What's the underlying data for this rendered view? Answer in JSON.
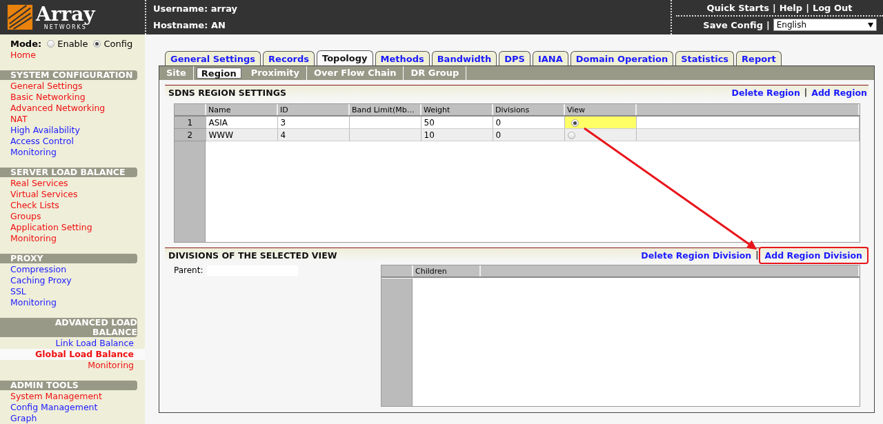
{
  "header": {
    "logo": {
      "name": "Array",
      "tagline": "NETWORKS"
    },
    "username": "Username: array",
    "hostname": "Hostname: AN",
    "links": [
      "Quick Starts",
      "Help",
      "Log Out"
    ],
    "separator": "|",
    "save_config": "Save Config",
    "language": "English"
  },
  "sidebar": {
    "mode_label": "Mode:",
    "modes": [
      {
        "label": "Enable",
        "selected": false
      },
      {
        "label": "Config",
        "selected": true
      }
    ],
    "home": {
      "label": "Home",
      "color": "#f01010"
    },
    "sections": [
      {
        "title": "SYSTEM CONFIGURATION",
        "selected": false,
        "items": [
          {
            "label": "General Settings",
            "color": "#f01010",
            "selected": false
          },
          {
            "label": "Basic Networking",
            "color": "#f01010",
            "selected": false
          },
          {
            "label": "Advanced Networking",
            "color": "#f01010",
            "selected": false
          },
          {
            "label": "NAT",
            "color": "#f01010",
            "selected": false
          },
          {
            "label": "High Availability",
            "color": "#1a1aff",
            "selected": false
          },
          {
            "label": "Access Control",
            "color": "#1a1aff",
            "selected": false
          },
          {
            "label": "Monitoring",
            "color": "#1a1aff",
            "selected": false
          }
        ]
      },
      {
        "title": "SERVER LOAD BALANCE",
        "selected": false,
        "items": [
          {
            "label": "Real Services",
            "color": "#f01010",
            "selected": false
          },
          {
            "label": "Virtual Services",
            "color": "#f01010",
            "selected": false
          },
          {
            "label": "Check Lists",
            "color": "#f01010",
            "selected": false
          },
          {
            "label": "Groups",
            "color": "#f01010",
            "selected": false
          },
          {
            "label": "Application Setting",
            "color": "#f01010",
            "selected": false
          },
          {
            "label": "Monitoring",
            "color": "#f01010",
            "selected": false
          }
        ]
      },
      {
        "title": "PROXY",
        "selected": false,
        "items": [
          {
            "label": "Compression",
            "color": "#1a1aff",
            "selected": false
          },
          {
            "label": "Caching Proxy",
            "color": "#1a1aff",
            "selected": false
          },
          {
            "label": "SSL",
            "color": "#1a1aff",
            "selected": false
          },
          {
            "label": "Monitoring",
            "color": "#1a1aff",
            "selected": false
          }
        ]
      },
      {
        "title": "ADVANCED LOAD BALANCE",
        "selected": true,
        "items": [
          {
            "label": "Link Load Balance",
            "color": "#1a1aff",
            "selected": false
          },
          {
            "label": "Global Load Balance",
            "color": "#f01010",
            "selected": true
          },
          {
            "label": "Monitoring",
            "color": "#f01010",
            "selected": false
          }
        ]
      },
      {
        "title": "ADMIN TOOLS",
        "selected": false,
        "items": [
          {
            "label": "System Management",
            "color": "#f01010",
            "selected": false
          },
          {
            "label": "Config Management",
            "color": "#1a1aff",
            "selected": false
          },
          {
            "label": "Graph",
            "color": "#1a1aff",
            "selected": false
          }
        ]
      }
    ]
  },
  "main": {
    "tabs": [
      {
        "label": "General Settings",
        "selected": false
      },
      {
        "label": "Records",
        "selected": false
      },
      {
        "label": "Topology",
        "selected": true
      },
      {
        "label": "Methods",
        "selected": false
      },
      {
        "label": "Bandwidth",
        "selected": false
      },
      {
        "label": "DPS",
        "selected": false
      },
      {
        "label": "IANA",
        "selected": false
      },
      {
        "label": "Domain Operation",
        "selected": false
      },
      {
        "label": "Statistics",
        "selected": false
      },
      {
        "label": "Report",
        "selected": false
      }
    ],
    "subtabs": [
      {
        "label": "Site",
        "selected": false
      },
      {
        "label": "Region",
        "selected": true
      },
      {
        "label": "Proximity",
        "selected": false
      },
      {
        "label": "Over Flow Chain",
        "selected": false
      },
      {
        "label": "DR Group",
        "selected": false
      }
    ],
    "region_settings": {
      "title": "SDNS REGION SETTINGS",
      "actions": [
        {
          "label": "Delete Region",
          "highlighted": false
        },
        {
          "label": "Add Region",
          "highlighted": false
        }
      ],
      "table": {
        "columns": [
          "Name",
          "ID",
          "Band Limit(Mb…",
          "Weight",
          "Divisions",
          "View"
        ],
        "rows": [
          {
            "number": "1",
            "name": "ASIA",
            "id": "3",
            "band_limit": "",
            "weight": "50",
            "divisions": "0",
            "selected": true
          },
          {
            "number": "2",
            "name": "WWW",
            "id": "4",
            "band_limit": "",
            "weight": "10",
            "divisions": "0",
            "selected": false
          }
        ]
      }
    },
    "divisions": {
      "title": "DIVISIONS OF THE SELECTED VIEW",
      "actions": [
        {
          "label": "Delete Region Division",
          "highlighted": false
        },
        {
          "label": "Add Region Division",
          "highlighted": true
        }
      ],
      "parent_label": "Parent:",
      "table": {
        "columns": [
          "Children"
        ]
      }
    }
  }
}
